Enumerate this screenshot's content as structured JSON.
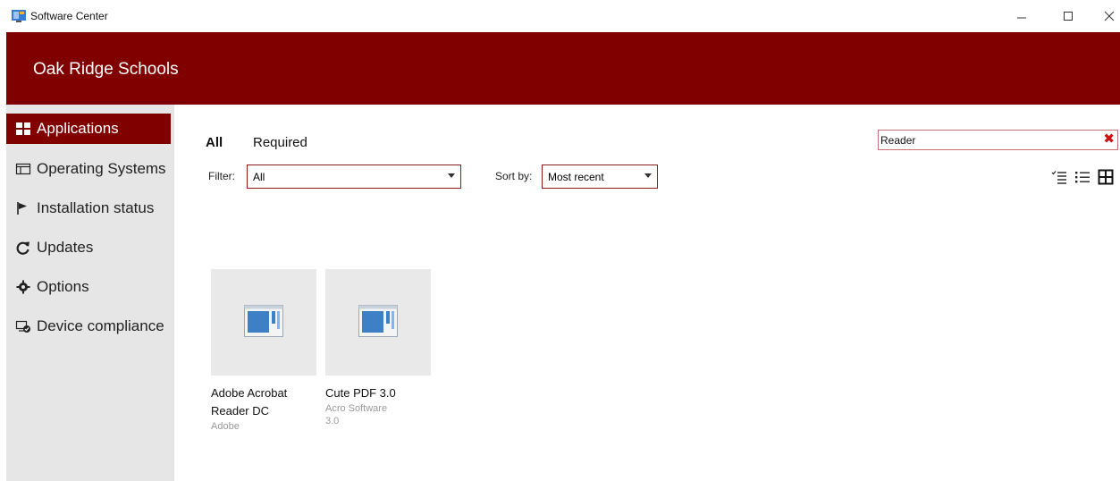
{
  "window": {
    "title": "Software Center",
    "minimize_icon": "minimize-icon",
    "maximize_icon": "maximize-icon",
    "close_icon": "close-icon"
  },
  "banner": {
    "org_name": "Oak Ridge Schools",
    "color": "#800000"
  },
  "sidebar": {
    "items": [
      {
        "label": "Applications",
        "icon": "apps-grid-icon",
        "active": true
      },
      {
        "label": "Operating Systems",
        "icon": "windows-icon",
        "active": false
      },
      {
        "label": "Installation status",
        "icon": "flag-icon",
        "active": false
      },
      {
        "label": "Updates",
        "icon": "refresh-icon",
        "active": false
      },
      {
        "label": "Options",
        "icon": "gear-icon",
        "active": false
      },
      {
        "label": "Device compliance",
        "icon": "device-check-icon",
        "active": false
      }
    ]
  },
  "tabs": [
    {
      "label": "All",
      "selected": true
    },
    {
      "label": "Required",
      "selected": false
    }
  ],
  "filter": {
    "label": "Filter:",
    "value": "All"
  },
  "sort": {
    "label": "Sort by:",
    "value": "Most recent"
  },
  "search": {
    "value": "Reader"
  },
  "view_modes": [
    "checklist-view-icon",
    "list-view-icon",
    "tile-view-icon"
  ],
  "apps": [
    {
      "name": "Adobe Acrobat Reader DC",
      "publisher": "Adobe",
      "version": ""
    },
    {
      "name": "Cute PDF 3.0",
      "publisher": "Acro Software",
      "version": "3.0"
    }
  ]
}
